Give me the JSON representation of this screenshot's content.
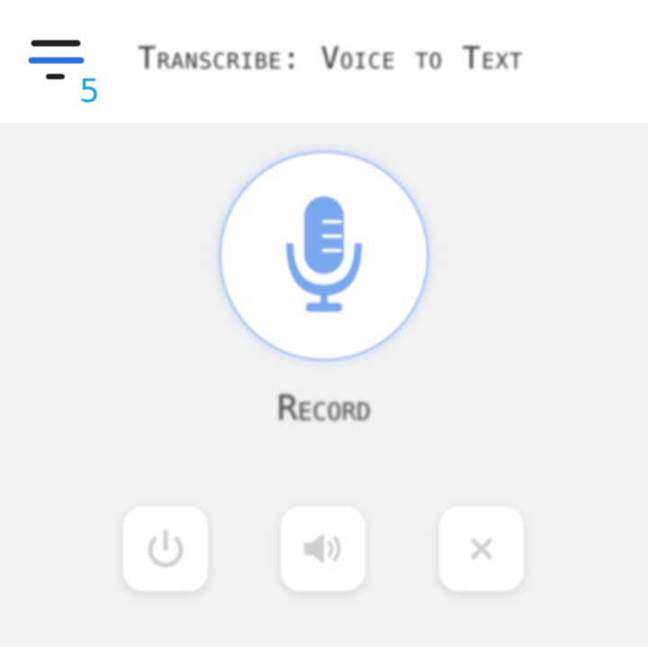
{
  "header": {
    "title": "Transcribe: Voice to Text",
    "menu_icon": "filter-lines-icon",
    "badge_count": "5",
    "colors": {
      "background": "#ffffff",
      "accent_line": "#2f6fe4",
      "badge": "#1aa3e8"
    }
  },
  "main": {
    "record_button": {
      "icon": "microphone-icon",
      "label": "Record",
      "colors": {
        "ring": "#a9c9f5",
        "icon": "#7aa8ee"
      }
    },
    "controls": [
      {
        "name": "power",
        "icon": "power-icon"
      },
      {
        "name": "sound",
        "icon": "speaker-icon"
      },
      {
        "name": "close",
        "icon": "close-icon"
      }
    ],
    "colors": {
      "background": "#f1f1f1",
      "control_icon": "#cfcfcf"
    }
  }
}
